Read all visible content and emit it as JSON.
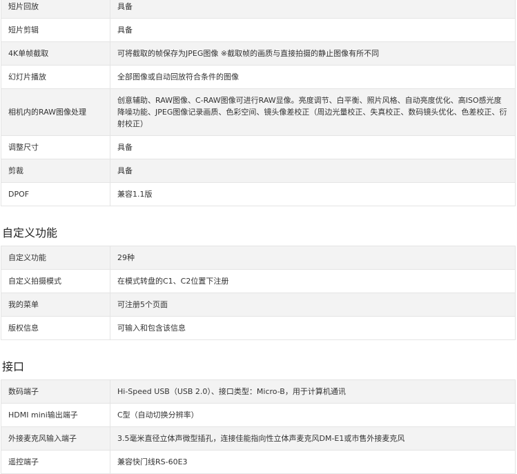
{
  "playback_rows": [
    {
      "label": "短片回放",
      "value": "具备"
    },
    {
      "label": "短片剪辑",
      "value": "具备"
    },
    {
      "label": "4K单帧截取",
      "value": "可将截取的帧保存为JPEG图像 ※截取帧的画质与直接拍摄的静止图像有所不同"
    },
    {
      "label": "幻灯片播放",
      "value": "全部图像或自动回放符合条件的图像"
    },
    {
      "label": "相机内的RAW图像处理",
      "value": "创意辅助、RAW图像、C-RAW图像可进行RAW显像。亮度调节、白平衡、照片风格、自动亮度优化、高ISO感光度降噪功能、JPEG图像记录画质、色彩空间、镜头像差校正（周边光量校正、失真校正、数码镜头优化、色差校正、衍射校正）"
    },
    {
      "label": "调整尺寸",
      "value": "具备"
    },
    {
      "label": "剪裁",
      "value": "具备"
    },
    {
      "label": "DPOF",
      "value": "兼容1.1版"
    }
  ],
  "custom_section": {
    "title": "自定义功能",
    "rows": [
      {
        "label": "自定义功能",
        "value": "29种"
      },
      {
        "label": "自定义拍摄模式",
        "value": "在模式转盘的C1、C2位置下注册"
      },
      {
        "label": "我的菜单",
        "value": "可注册5个页面"
      },
      {
        "label": "版权信息",
        "value": "可输入和包含该信息"
      }
    ]
  },
  "interface_section": {
    "title": "接口",
    "rows": [
      {
        "label": "数码端子",
        "value": "Hi-Speed USB（USB 2.0）、接口类型：Micro-B，用于计算机通讯"
      },
      {
        "label": "HDMI mini输出端子",
        "value": "C型（自动切换分辨率）"
      },
      {
        "label": "外接麦克风输入端子",
        "value": "3.5毫米直径立体声微型插孔，连接佳能指向性立体声麦克风DM-E1或市售外接麦克风"
      },
      {
        "label": "遥控端子",
        "value": "兼容快门线RS-60E3"
      }
    ]
  }
}
